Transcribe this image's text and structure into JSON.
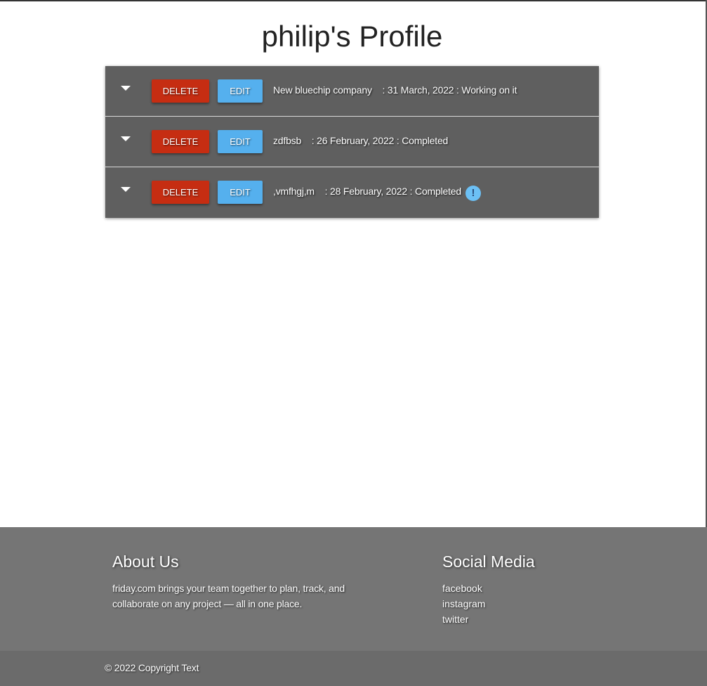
{
  "page": {
    "title": "philip's Profile"
  },
  "tasks": [
    {
      "delete_label": "DELETE",
      "edit_label": "EDIT",
      "text": "New bluechip company    : 31 March, 2022 : Working on it",
      "has_alert": false
    },
    {
      "delete_label": "DELETE",
      "edit_label": "EDIT",
      "text": "zdfbsb    : 26 February, 2022 : Completed",
      "has_alert": false
    },
    {
      "delete_label": "DELETE",
      "edit_label": "EDIT",
      "text": ",vmfhgj,m    : 28 February, 2022 : Completed",
      "has_alert": true,
      "alert_glyph": "!"
    }
  ],
  "footer": {
    "about": {
      "title": "About Us",
      "text": "friday.com brings your team together to plan, track, and collaborate on any project — all in one place."
    },
    "social": {
      "title": "Social Media",
      "links": [
        "facebook",
        "instagram",
        "twitter"
      ]
    },
    "copyright": "© 2022 Copyright Text"
  },
  "colors": {
    "row_bg": "#5f5f5f",
    "delete": "#c62d12",
    "edit": "#55b0ee",
    "footer_bg": "#757575",
    "copyright_bg": "#6b6b6b",
    "alert": "#6cc0f5"
  },
  "icons": {
    "row_toggle": "chevron-down-icon",
    "alert": "exclamation-circle-icon"
  }
}
